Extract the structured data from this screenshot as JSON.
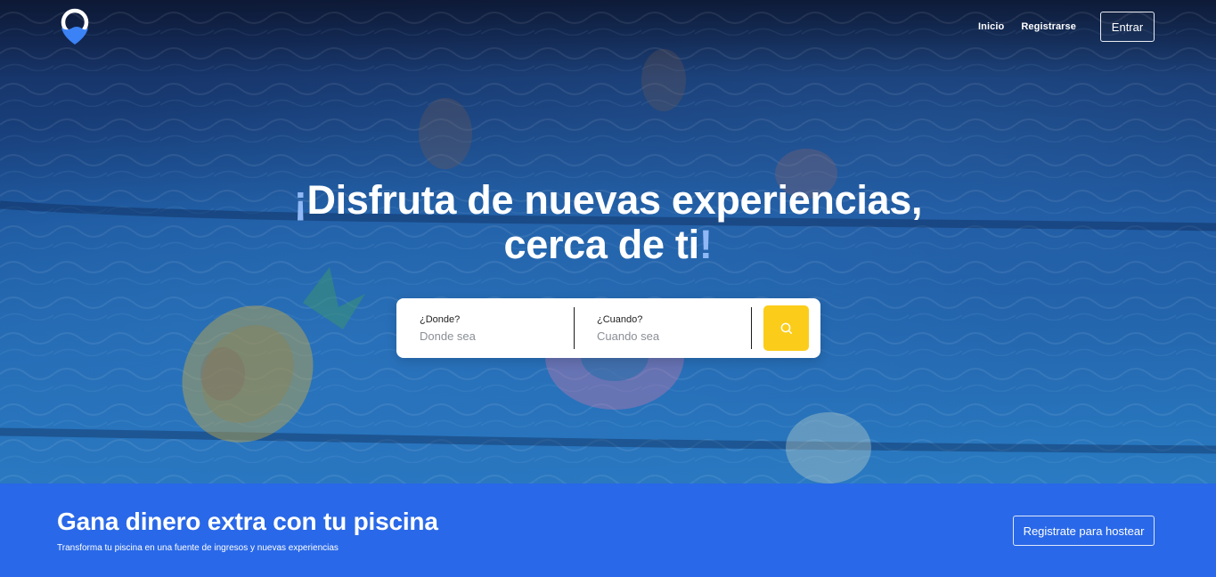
{
  "nav": {
    "logo_icon": "map-pin-wave-icon",
    "links": [
      {
        "label": "Inicio"
      },
      {
        "label": "Registrarse"
      }
    ],
    "enter_label": "Entrar"
  },
  "hero": {
    "headline_open": "¡",
    "headline_line1": "Disfruta de nuevas experiencias,",
    "headline_line2": "cerca de ti",
    "headline_close": "!"
  },
  "search": {
    "where_label": "¿Donde?",
    "where_placeholder": "Donde sea",
    "when_label": "¿Cuando?",
    "when_placeholder": "Cuando sea",
    "button_icon": "search-icon"
  },
  "host": {
    "title": "Gana dinero extra con tu piscina",
    "subtitle": "Transforma tu piscina en una fuente de ingresos y nuevas experiencias",
    "button_label": "Registrate para hostear"
  },
  "colors": {
    "brand_blue": "#2968e8",
    "search_button": "#fbcd1a",
    "accent_light_blue": "#8fb8f5"
  }
}
